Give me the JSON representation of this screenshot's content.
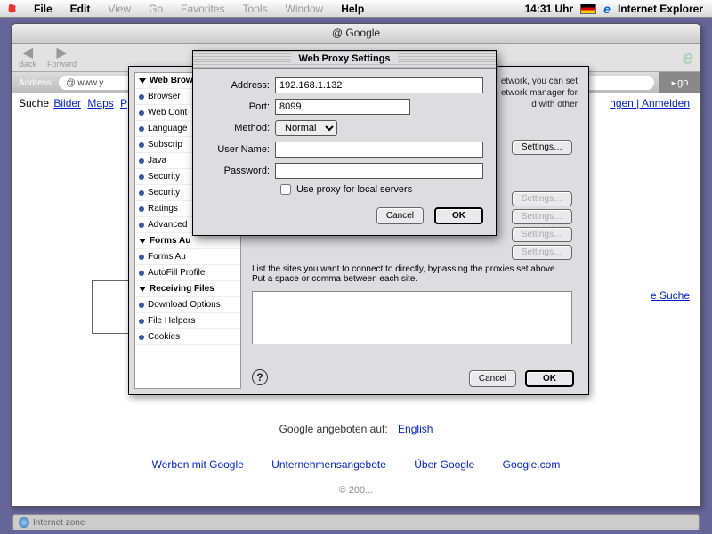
{
  "menubar": {
    "items": [
      "File",
      "Edit",
      "View",
      "Go",
      "Favorites",
      "Tools",
      "Window",
      "Help"
    ],
    "clock": "14:31 Uhr",
    "app": "Internet Explorer"
  },
  "window": {
    "title": "@ Google",
    "back": "Back",
    "forward": "Forward",
    "address_label": "Address:",
    "address_value": "@ www.y",
    "go": "go"
  },
  "page": {
    "nav": {
      "suche": "Suche",
      "bilder": "Bilder",
      "maps": "Maps",
      "more": "P"
    },
    "top_right": "ngen | Anmelden",
    "side": "e Suche",
    "offered": "Google angeboten auf:",
    "offered_lang": "English",
    "links": [
      "Werben mit Google",
      "Unternehmensangebote",
      "Über Google",
      "Google.com"
    ],
    "copy": "© 200..."
  },
  "status": "Internet zone",
  "prefs": {
    "groups": [
      {
        "header": "Web Brow",
        "items": [
          "Browser",
          "Web Cont",
          "Language",
          "Subscrip",
          "Java",
          "Security",
          "Security",
          "Ratings",
          "Advanced"
        ]
      },
      {
        "header": "Forms Au",
        "items": [
          "Forms Au",
          "AutoFill Profile"
        ]
      },
      {
        "header": "Receiving Files",
        "items": [
          "Download Options",
          "File Helpers",
          "Cookies"
        ]
      }
    ],
    "info_text": "etwork, you can set\network manager for\nd with other",
    "bypass_text": "List the sites you want to connect to directly, bypassing the proxies set above.  Put a space or comma between each site.",
    "settings": "Settings…",
    "cancel": "Cancel",
    "ok": "OK"
  },
  "proxy": {
    "title": "Web Proxy Settings",
    "labels": {
      "address": "Address:",
      "port": "Port:",
      "method": "Method:",
      "user": "User Name:",
      "password": "Password:"
    },
    "values": {
      "address": "192.168.1.132",
      "port": "8099",
      "method": "Normal",
      "user": "",
      "password": ""
    },
    "use_local": "Use proxy for local servers",
    "cancel": "Cancel",
    "ok": "OK"
  }
}
